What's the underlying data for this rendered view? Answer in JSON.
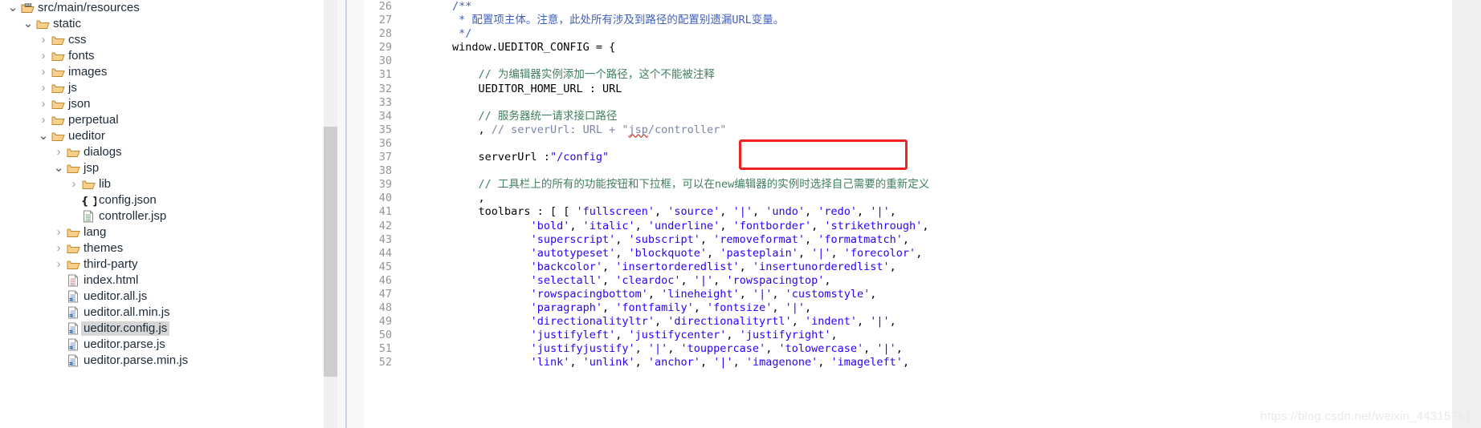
{
  "explorer": {
    "name": "project-explorer",
    "tree": [
      {
        "label": "src/main/resources",
        "indent": 0,
        "twisty": "expanded",
        "icon": "source-folder-icon",
        "selected": false
      },
      {
        "label": "static",
        "indent": 1,
        "twisty": "expanded",
        "icon": "folder-icon",
        "selected": false
      },
      {
        "label": "css",
        "indent": 2,
        "twisty": "collapsed",
        "icon": "folder-icon",
        "selected": false
      },
      {
        "label": "fonts",
        "indent": 2,
        "twisty": "collapsed",
        "icon": "folder-icon",
        "selected": false
      },
      {
        "label": "images",
        "indent": 2,
        "twisty": "collapsed",
        "icon": "folder-icon",
        "selected": false
      },
      {
        "label": "js",
        "indent": 2,
        "twisty": "collapsed",
        "icon": "folder-icon",
        "selected": false
      },
      {
        "label": "json",
        "indent": 2,
        "twisty": "collapsed",
        "icon": "folder-icon",
        "selected": false
      },
      {
        "label": "perpetual",
        "indent": 2,
        "twisty": "collapsed",
        "icon": "folder-icon",
        "selected": false
      },
      {
        "label": "ueditor",
        "indent": 2,
        "twisty": "expanded",
        "icon": "folder-icon",
        "selected": false
      },
      {
        "label": "dialogs",
        "indent": 3,
        "twisty": "collapsed",
        "icon": "folder-icon",
        "selected": false
      },
      {
        "label": "jsp",
        "indent": 3,
        "twisty": "expanded",
        "icon": "folder-icon",
        "selected": false
      },
      {
        "label": "lib",
        "indent": 4,
        "twisty": "collapsed",
        "icon": "folder-icon",
        "selected": false
      },
      {
        "label": "config.json",
        "indent": 4,
        "twisty": "none",
        "icon": "json-file-icon",
        "selected": false
      },
      {
        "label": "controller.jsp",
        "indent": 4,
        "twisty": "none",
        "icon": "jsp-file-icon",
        "selected": false
      },
      {
        "label": "lang",
        "indent": 3,
        "twisty": "collapsed",
        "icon": "folder-icon",
        "selected": false
      },
      {
        "label": "themes",
        "indent": 3,
        "twisty": "collapsed",
        "icon": "folder-icon",
        "selected": false
      },
      {
        "label": "third-party",
        "indent": 3,
        "twisty": "collapsed",
        "icon": "folder-icon",
        "selected": false
      },
      {
        "label": "index.html",
        "indent": 3,
        "twisty": "none",
        "icon": "html-file-icon",
        "selected": false
      },
      {
        "label": "ueditor.all.js",
        "indent": 3,
        "twisty": "none",
        "icon": "js-file-icon",
        "selected": false
      },
      {
        "label": "ueditor.all.min.js",
        "indent": 3,
        "twisty": "none",
        "icon": "js-file-icon",
        "selected": false
      },
      {
        "label": "ueditor.config.js",
        "indent": 3,
        "twisty": "none",
        "icon": "js-file-icon",
        "selected": true
      },
      {
        "label": "ueditor.parse.js",
        "indent": 3,
        "twisty": "none",
        "icon": "js-file-icon",
        "selected": false
      },
      {
        "label": "ueditor.parse.min.js",
        "indent": 3,
        "twisty": "none",
        "icon": "js-file-icon",
        "selected": false
      }
    ]
  },
  "editor": {
    "name": "code-editor",
    "first_line_number": 26,
    "lines": [
      {
        "n": 26,
        "tokens": [
          {
            "t": "        ",
            "c": "plain"
          },
          {
            "t": "/**",
            "c": "doc"
          }
        ]
      },
      {
        "n": 27,
        "tokens": [
          {
            "t": "         ",
            "c": "plain"
          },
          {
            "t": "* 配置项主体。注意，此处所有涉及到路径的配置别遗漏URL变量。",
            "c": "doc"
          }
        ]
      },
      {
        "n": 28,
        "tokens": [
          {
            "t": "         ",
            "c": "plain"
          },
          {
            "t": "*/",
            "c": "doc"
          }
        ]
      },
      {
        "n": 29,
        "tokens": [
          {
            "t": "        window.UEDITOR_CONFIG = {",
            "c": "plain"
          }
        ]
      },
      {
        "n": 30,
        "tokens": [
          {
            "t": "",
            "c": "plain"
          }
        ]
      },
      {
        "n": 31,
        "tokens": [
          {
            "t": "            ",
            "c": "plain"
          },
          {
            "t": "// 为编辑器实例添加一个路径，这个不能被注释",
            "c": "comment"
          }
        ]
      },
      {
        "n": 32,
        "tokens": [
          {
            "t": "            UEDITOR_HOME_URL : URL",
            "c": "plain"
          }
        ]
      },
      {
        "n": 33,
        "tokens": [
          {
            "t": "",
            "c": "plain"
          }
        ]
      },
      {
        "n": 34,
        "tokens": [
          {
            "t": "            ",
            "c": "plain"
          },
          {
            "t": "// 服务器统一请求接口路径",
            "c": "comment"
          }
        ]
      },
      {
        "n": 35,
        "tokens": [
          {
            "t": "            , ",
            "c": "plain"
          },
          {
            "t": "// serverUrl: URL + \"",
            "c": "comment2"
          },
          {
            "t": "jsp",
            "c": "comment2-squiggle"
          },
          {
            "t": "/controller\"",
            "c": "comment2"
          }
        ]
      },
      {
        "n": 36,
        "tokens": [
          {
            "t": "",
            "c": "plain"
          }
        ]
      },
      {
        "n": 37,
        "tokens": [
          {
            "t": "            serverUrl :",
            "c": "plain"
          },
          {
            "t": "\"/config\"",
            "c": "str"
          }
        ]
      },
      {
        "n": 38,
        "tokens": [
          {
            "t": "",
            "c": "plain"
          }
        ]
      },
      {
        "n": 39,
        "tokens": [
          {
            "t": "            ",
            "c": "plain"
          },
          {
            "t": "// 工具栏上的所有的功能按钮和下拉框，可以在new编辑器的实例时选择自己需要的重新定义",
            "c": "comment"
          }
        ]
      },
      {
        "n": 40,
        "tokens": [
          {
            "t": "            ,",
            "c": "plain"
          }
        ]
      },
      {
        "n": 41,
        "tokens": [
          {
            "t": "            toolbars : [ [ ",
            "c": "plain"
          },
          {
            "t": "'fullscreen'",
            "c": "str"
          },
          {
            "t": ", ",
            "c": "plain"
          },
          {
            "t": "'source'",
            "c": "str"
          },
          {
            "t": ", ",
            "c": "plain"
          },
          {
            "t": "'|'",
            "c": "str"
          },
          {
            "t": ", ",
            "c": "plain"
          },
          {
            "t": "'undo'",
            "c": "str"
          },
          {
            "t": ", ",
            "c": "plain"
          },
          {
            "t": "'redo'",
            "c": "str"
          },
          {
            "t": ", ",
            "c": "plain"
          },
          {
            "t": "'|'",
            "c": "str"
          },
          {
            "t": ",",
            "c": "plain"
          }
        ]
      },
      {
        "n": 42,
        "tokens": [
          {
            "t": "                    ",
            "c": "plain"
          },
          {
            "t": "'bold'",
            "c": "str"
          },
          {
            "t": ", ",
            "c": "plain"
          },
          {
            "t": "'italic'",
            "c": "str"
          },
          {
            "t": ", ",
            "c": "plain"
          },
          {
            "t": "'underline'",
            "c": "str"
          },
          {
            "t": ", ",
            "c": "plain"
          },
          {
            "t": "'fontborder'",
            "c": "str"
          },
          {
            "t": ", ",
            "c": "plain"
          },
          {
            "t": "'strikethrough'",
            "c": "str"
          },
          {
            "t": ",",
            "c": "plain"
          }
        ]
      },
      {
        "n": 43,
        "tokens": [
          {
            "t": "                    ",
            "c": "plain"
          },
          {
            "t": "'superscript'",
            "c": "str"
          },
          {
            "t": ", ",
            "c": "plain"
          },
          {
            "t": "'subscript'",
            "c": "str"
          },
          {
            "t": ", ",
            "c": "plain"
          },
          {
            "t": "'removeformat'",
            "c": "str"
          },
          {
            "t": ", ",
            "c": "plain"
          },
          {
            "t": "'formatmatch'",
            "c": "str"
          },
          {
            "t": ",",
            "c": "plain"
          }
        ]
      },
      {
        "n": 44,
        "tokens": [
          {
            "t": "                    ",
            "c": "plain"
          },
          {
            "t": "'autotypeset'",
            "c": "str"
          },
          {
            "t": ", ",
            "c": "plain"
          },
          {
            "t": "'blockquote'",
            "c": "str"
          },
          {
            "t": ", ",
            "c": "plain"
          },
          {
            "t": "'pasteplain'",
            "c": "str"
          },
          {
            "t": ", ",
            "c": "plain"
          },
          {
            "t": "'|'",
            "c": "str"
          },
          {
            "t": ", ",
            "c": "plain"
          },
          {
            "t": "'forecolor'",
            "c": "str"
          },
          {
            "t": ",",
            "c": "plain"
          }
        ]
      },
      {
        "n": 45,
        "tokens": [
          {
            "t": "                    ",
            "c": "plain"
          },
          {
            "t": "'backcolor'",
            "c": "str"
          },
          {
            "t": ", ",
            "c": "plain"
          },
          {
            "t": "'insertorderedlist'",
            "c": "str"
          },
          {
            "t": ", ",
            "c": "plain"
          },
          {
            "t": "'insertunorderedlist'",
            "c": "str"
          },
          {
            "t": ",",
            "c": "plain"
          }
        ]
      },
      {
        "n": 46,
        "tokens": [
          {
            "t": "                    ",
            "c": "plain"
          },
          {
            "t": "'selectall'",
            "c": "str"
          },
          {
            "t": ", ",
            "c": "plain"
          },
          {
            "t": "'cleardoc'",
            "c": "str"
          },
          {
            "t": ", ",
            "c": "plain"
          },
          {
            "t": "'|'",
            "c": "str"
          },
          {
            "t": ", ",
            "c": "plain"
          },
          {
            "t": "'rowspacingtop'",
            "c": "str"
          },
          {
            "t": ",",
            "c": "plain"
          }
        ]
      },
      {
        "n": 47,
        "tokens": [
          {
            "t": "                    ",
            "c": "plain"
          },
          {
            "t": "'rowspacingbottom'",
            "c": "str"
          },
          {
            "t": ", ",
            "c": "plain"
          },
          {
            "t": "'lineheight'",
            "c": "str"
          },
          {
            "t": ", ",
            "c": "plain"
          },
          {
            "t": "'|'",
            "c": "str"
          },
          {
            "t": ", ",
            "c": "plain"
          },
          {
            "t": "'customstyle'",
            "c": "str"
          },
          {
            "t": ",",
            "c": "plain"
          }
        ]
      },
      {
        "n": 48,
        "tokens": [
          {
            "t": "                    ",
            "c": "plain"
          },
          {
            "t": "'paragraph'",
            "c": "str"
          },
          {
            "t": ", ",
            "c": "plain"
          },
          {
            "t": "'fontfamily'",
            "c": "str"
          },
          {
            "t": ", ",
            "c": "plain"
          },
          {
            "t": "'fontsize'",
            "c": "str"
          },
          {
            "t": ", ",
            "c": "plain"
          },
          {
            "t": "'|'",
            "c": "str"
          },
          {
            "t": ",",
            "c": "plain"
          }
        ]
      },
      {
        "n": 49,
        "tokens": [
          {
            "t": "                    ",
            "c": "plain"
          },
          {
            "t": "'directionalityltr'",
            "c": "str"
          },
          {
            "t": ", ",
            "c": "plain"
          },
          {
            "t": "'directionalityrtl'",
            "c": "str"
          },
          {
            "t": ", ",
            "c": "plain"
          },
          {
            "t": "'indent'",
            "c": "str"
          },
          {
            "t": ", ",
            "c": "plain"
          },
          {
            "t": "'|'",
            "c": "str"
          },
          {
            "t": ",",
            "c": "plain"
          }
        ]
      },
      {
        "n": 50,
        "tokens": [
          {
            "t": "                    ",
            "c": "plain"
          },
          {
            "t": "'justifyleft'",
            "c": "str"
          },
          {
            "t": ", ",
            "c": "plain"
          },
          {
            "t": "'justifycenter'",
            "c": "str"
          },
          {
            "t": ", ",
            "c": "plain"
          },
          {
            "t": "'justifyright'",
            "c": "str"
          },
          {
            "t": ",",
            "c": "plain"
          }
        ]
      },
      {
        "n": 51,
        "tokens": [
          {
            "t": "                    ",
            "c": "plain"
          },
          {
            "t": "'justifyjustify'",
            "c": "str"
          },
          {
            "t": ", ",
            "c": "plain"
          },
          {
            "t": "'|'",
            "c": "str"
          },
          {
            "t": ", ",
            "c": "plain"
          },
          {
            "t": "'touppercase'",
            "c": "str"
          },
          {
            "t": ", ",
            "c": "plain"
          },
          {
            "t": "'tolowercase'",
            "c": "str"
          },
          {
            "t": ", ",
            "c": "plain"
          },
          {
            "t": "'|'",
            "c": "str"
          },
          {
            "t": ",",
            "c": "plain"
          }
        ]
      },
      {
        "n": 52,
        "tokens": [
          {
            "t": "                    ",
            "c": "plain"
          },
          {
            "t": "'link'",
            "c": "str"
          },
          {
            "t": ", ",
            "c": "plain"
          },
          {
            "t": "'unlink'",
            "c": "str"
          },
          {
            "t": ", ",
            "c": "plain"
          },
          {
            "t": "'anchor'",
            "c": "str"
          },
          {
            "t": ", ",
            "c": "plain"
          },
          {
            "t": "'|'",
            "c": "str"
          },
          {
            "t": ", ",
            "c": "plain"
          },
          {
            "t": "'imagenone'",
            "c": "str"
          },
          {
            "t": ", ",
            "c": "plain"
          },
          {
            "t": "'imageleft'",
            "c": "str"
          },
          {
            "t": ",",
            "c": "plain"
          }
        ]
      }
    ]
  },
  "annotation": {
    "name": "red-highlight-box",
    "targets_line": 37,
    "color": "#ee2222"
  },
  "watermark": {
    "text": "https://blog.csdn.net/weixin_44315761",
    "color": "#e9e9e9"
  },
  "colors": {
    "selection": "#d6d6d6",
    "string": "#2a00ff",
    "comment": "#3f7f5f",
    "javadoc": "#3f5fbf",
    "linenumber": "#919699",
    "scrollbar_thumb": "#cdcdcd",
    "scrollbar_track": "#f0f0f0"
  }
}
